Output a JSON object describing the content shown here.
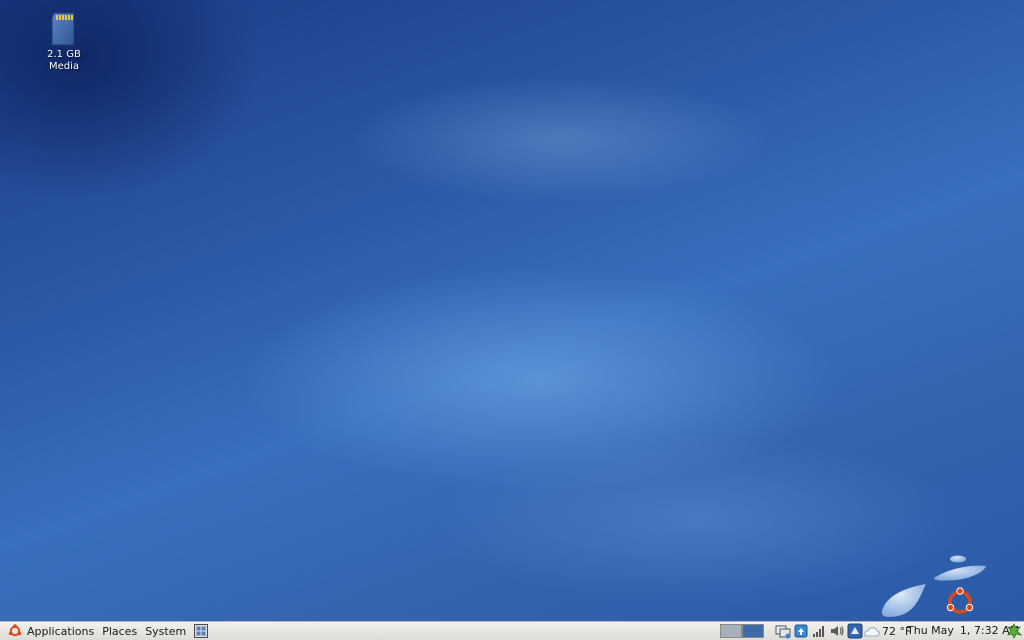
{
  "desktop": {
    "icons": [
      {
        "name": "sd-card-icon",
        "label_line1": "2.1 GB",
        "label_line2": "Media"
      }
    ]
  },
  "panel": {
    "menus": {
      "applications": "Applications",
      "places": "Places",
      "system": "System"
    },
    "workspaces": {
      "count": 2,
      "active_index": 1
    },
    "tray_icons": [
      "network-icon",
      "update-notifier-icon",
      "signal-strength-icon",
      "volume-icon",
      "display-settings-icon"
    ],
    "weather": {
      "temperature": "72 °F"
    },
    "clock": {
      "day": "Thu",
      "month": "May",
      "date": "1,",
      "time": "7:32 AM"
    }
  },
  "colors": {
    "panel_bg": "#e6e4de",
    "desktop_blue": "#3a6fbd",
    "active_workspace": "#3c6ba8",
    "ubuntu_orange": "#dd4814"
  }
}
